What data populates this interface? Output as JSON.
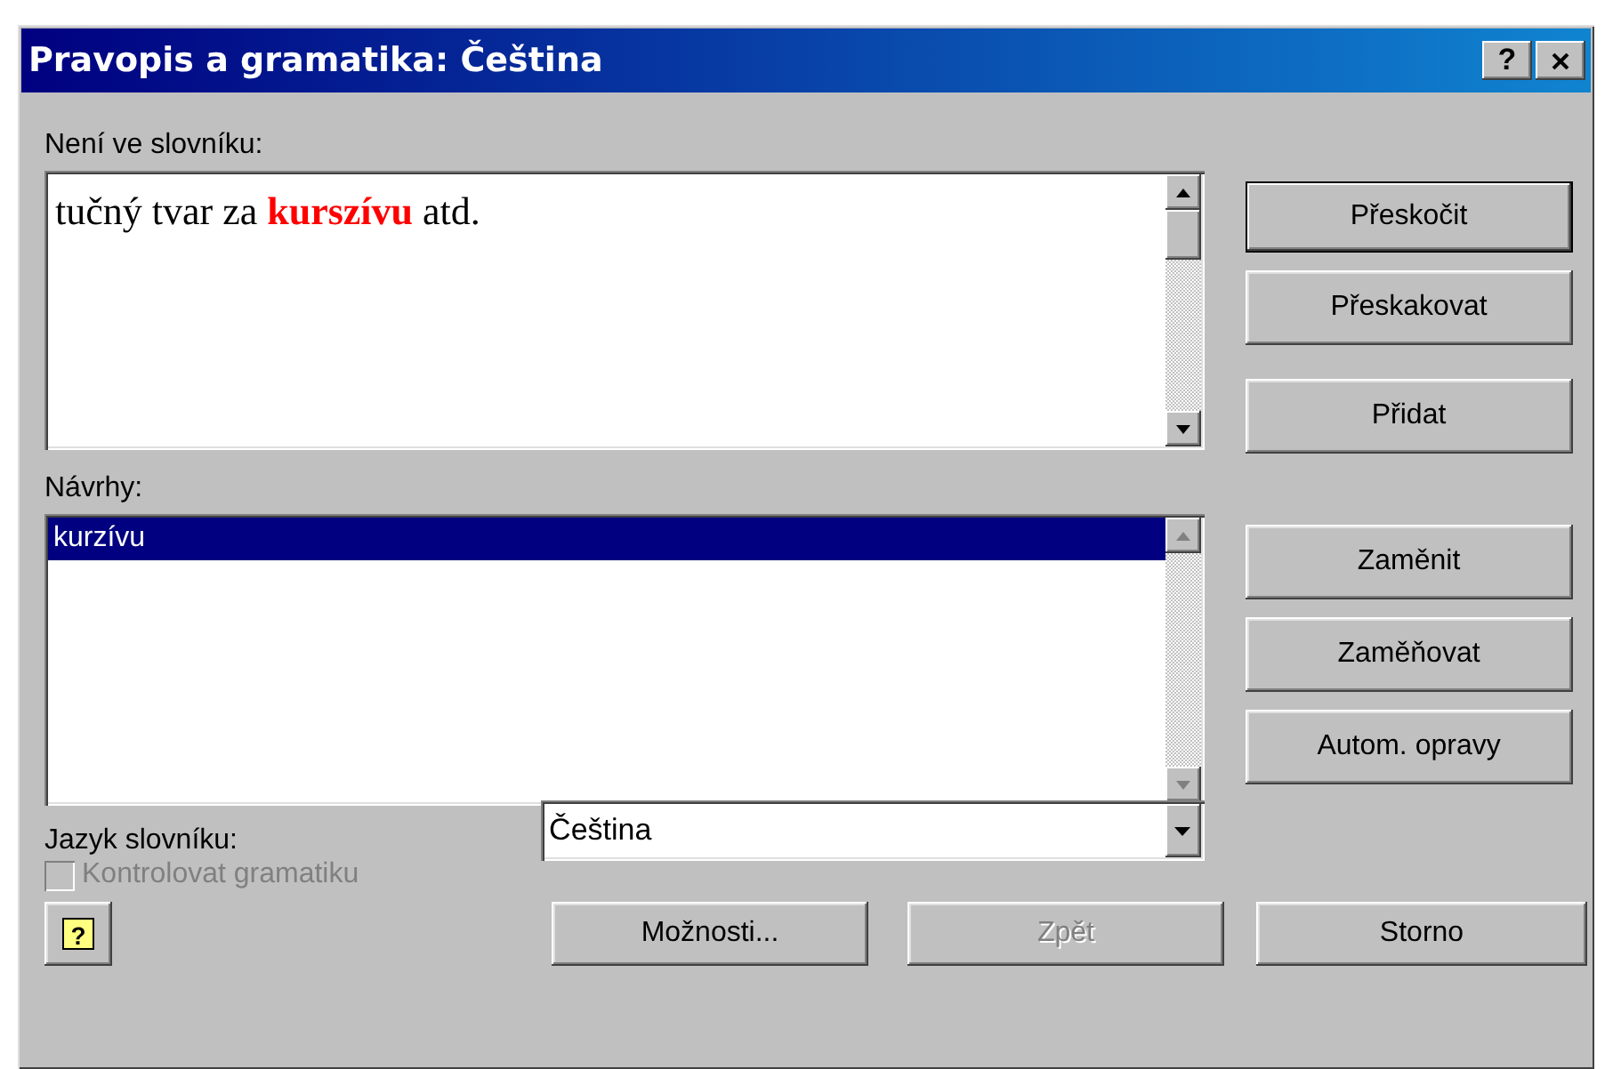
{
  "window": {
    "title": "Pravopis a gramatika: Čeština",
    "title_buttons": [
      {
        "kind": "help",
        "label": "?"
      },
      {
        "kind": "close"
      }
    ]
  },
  "not_in_dictionary": {
    "label": "Není ve slovníku:",
    "text": "tučný tvar za **kurszívu** atd."
  },
  "suggestions": {
    "label": "Návrhy:",
    "items": [
      {
        "text": "kurzívu",
        "selected": true
      }
    ]
  },
  "side_buttons": [
    {
      "label": "Přeskočit",
      "default": true
    },
    {
      "label": "Přeskakovat",
      "default": false
    },
    {
      "label": "Přidat",
      "default": false
    },
    {
      "label": "Zaměnit",
      "default": false
    },
    {
      "label": "Zaměňovat",
      "default": false
    },
    {
      "label": "Autom. opravy",
      "default": false
    }
  ],
  "language": {
    "label": "Jazyk slovníku:",
    "value": "Čeština"
  },
  "grammar_check": {
    "label": "Kontrolovat gramatiku",
    "checked": false,
    "disabled": true
  },
  "help_button": {
    "label": "?"
  },
  "bottom_buttons": [
    {
      "label": "Možnosti...",
      "disabled": false
    },
    {
      "label": "Zpět",
      "disabled": true
    },
    {
      "label": "Storno",
      "disabled": false
    }
  ]
}
